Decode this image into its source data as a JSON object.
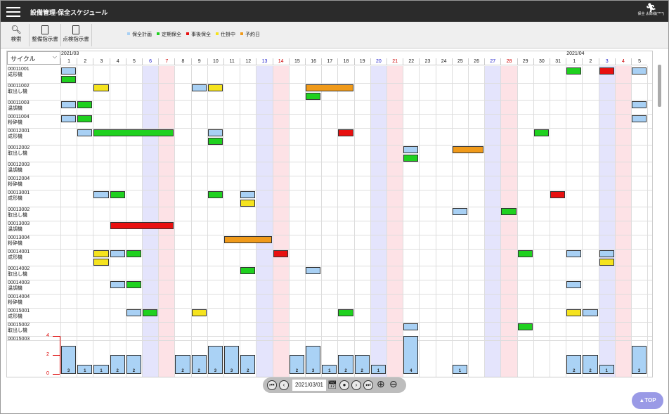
{
  "header": {
    "title": "設備管理-保全スケジュール",
    "user_role": "保全",
    "user_name": "太郎様(****)"
  },
  "toolbar": {
    "search": "検索",
    "maintenance_order": "整備指示書",
    "inspection_order": "点検指示書"
  },
  "legend": [
    {
      "label": "保全計画",
      "color": "#a8d0f4"
    },
    {
      "label": "定期保全",
      "color": "#1fd11f"
    },
    {
      "label": "事後保全",
      "color": "#e81010"
    },
    {
      "label": "仕掛中",
      "color": "#f5e31e"
    },
    {
      "label": "予約日",
      "color": "#f09a1a"
    }
  ],
  "cycle_select": "サイクル",
  "months": [
    {
      "label": "2021/03",
      "start": 0
    },
    {
      "label": "2021/04",
      "start": 31
    }
  ],
  "days": [
    "1",
    "2",
    "3",
    "4",
    "5",
    "6",
    "7",
    "8",
    "9",
    "10",
    "11",
    "12",
    "13",
    "14",
    "15",
    "16",
    "17",
    "18",
    "19",
    "20",
    "21",
    "22",
    "23",
    "24",
    "25",
    "26",
    "27",
    "28",
    "29",
    "30",
    "31",
    "1",
    "2",
    "3",
    "4",
    "5"
  ],
  "day_kinds": [
    "w",
    "w",
    "w",
    "w",
    "w",
    "sat",
    "sun",
    "w",
    "w",
    "w",
    "w",
    "w",
    "sat",
    "sun",
    "w",
    "w",
    "w",
    "w",
    "w",
    "sat",
    "sun",
    "w",
    "w",
    "w",
    "w",
    "w",
    "sat",
    "sun",
    "w",
    "w",
    "w",
    "w",
    "w",
    "sat",
    "sun",
    "w"
  ],
  "colors": {
    "plan": "#a8d0f4",
    "regular": "#1fd11f",
    "post": "#e81010",
    "wip": "#f5e31e",
    "reserve": "#f09a1a",
    "sat_bg": "#e4e4fc",
    "sun_bg": "#fde2e6",
    "sat_text": "#2222cc",
    "sun_text": "#cc0000"
  },
  "rows": [
    {
      "id": "00011001",
      "name": "成形機",
      "h": 24
    },
    {
      "id": "00011002",
      "name": "取出し機",
      "h": 24
    },
    {
      "id": "00011003",
      "name": "温調機",
      "h": 20
    },
    {
      "id": "00011004",
      "name": "粉砕機",
      "h": 20
    },
    {
      "id": "00012001",
      "name": "成形機",
      "h": 24
    },
    {
      "id": "00012002",
      "name": "取出し機",
      "h": 24
    },
    {
      "id": "00012003",
      "name": "温調機",
      "h": 20
    },
    {
      "id": "00012004",
      "name": "粉砕機",
      "h": 20
    },
    {
      "id": "00013001",
      "name": "成形機",
      "h": 24
    },
    {
      "id": "00013002",
      "name": "取出し機",
      "h": 20
    },
    {
      "id": "00013003",
      "name": "温調機",
      "h": 20
    },
    {
      "id": "00013004",
      "name": "粉砕機",
      "h": 20
    },
    {
      "id": "00014001",
      "name": "成形機",
      "h": 24
    },
    {
      "id": "00014002",
      "name": "取出し機",
      "h": 20
    },
    {
      "id": "00014003",
      "name": "温調機",
      "h": 20
    },
    {
      "id": "00014004",
      "name": "粉砕機",
      "h": 20
    },
    {
      "id": "00015001",
      "name": "成形機",
      "h": 20
    },
    {
      "id": "00015002",
      "name": "取出し機",
      "h": 20
    },
    {
      "id": "00015003",
      "name": "",
      "h": 6
    }
  ],
  "bars": [
    {
      "r": 0,
      "s": 0,
      "e": 0,
      "t": "plan",
      "l": 0
    },
    {
      "r": 0,
      "s": 0,
      "e": 0,
      "t": "regular",
      "l": 1
    },
    {
      "r": 0,
      "s": 31,
      "e": 31,
      "t": "regular",
      "l": 0
    },
    {
      "r": 0,
      "s": 33,
      "e": 33,
      "t": "post",
      "l": 0
    },
    {
      "r": 0,
      "s": 35,
      "e": 35,
      "t": "plan",
      "l": 0
    },
    {
      "r": 1,
      "s": 2,
      "e": 2,
      "t": "wip",
      "l": 0
    },
    {
      "r": 1,
      "s": 8,
      "e": 8,
      "t": "plan",
      "l": 0
    },
    {
      "r": 1,
      "s": 9,
      "e": 9,
      "t": "wip",
      "l": 0
    },
    {
      "r": 1,
      "s": 15,
      "e": 17,
      "t": "reserve",
      "l": 0
    },
    {
      "r": 1,
      "s": 15,
      "e": 15,
      "t": "regular",
      "l": 1
    },
    {
      "r": 2,
      "s": 0,
      "e": 0,
      "t": "plan",
      "l": 0
    },
    {
      "r": 2,
      "s": 1,
      "e": 1,
      "t": "regular",
      "l": 0
    },
    {
      "r": 2,
      "s": 35,
      "e": 35,
      "t": "plan",
      "l": 0
    },
    {
      "r": 3,
      "s": 0,
      "e": 0,
      "t": "plan",
      "l": 0
    },
    {
      "r": 3,
      "s": 1,
      "e": 1,
      "t": "regular",
      "l": 0
    },
    {
      "r": 3,
      "s": 35,
      "e": 35,
      "t": "plan",
      "l": 0
    },
    {
      "r": 4,
      "s": 1,
      "e": 1,
      "t": "plan",
      "l": 0
    },
    {
      "r": 4,
      "s": 2,
      "e": 6,
      "t": "regular",
      "l": 0
    },
    {
      "r": 4,
      "s": 9,
      "e": 9,
      "t": "plan",
      "l": 0
    },
    {
      "r": 4,
      "s": 9,
      "e": 9,
      "t": "regular",
      "l": 1
    },
    {
      "r": 4,
      "s": 17,
      "e": 17,
      "t": "post",
      "l": 0
    },
    {
      "r": 4,
      "s": 29,
      "e": 29,
      "t": "regular",
      "l": 0
    },
    {
      "r": 5,
      "s": 21,
      "e": 21,
      "t": "plan",
      "l": 0
    },
    {
      "r": 5,
      "s": 21,
      "e": 21,
      "t": "regular",
      "l": 1
    },
    {
      "r": 5,
      "s": 24,
      "e": 25,
      "t": "reserve",
      "l": 0
    },
    {
      "r": 8,
      "s": 2,
      "e": 2,
      "t": "plan",
      "l": 0
    },
    {
      "r": 8,
      "s": 3,
      "e": 3,
      "t": "regular",
      "l": 0
    },
    {
      "r": 8,
      "s": 9,
      "e": 9,
      "t": "regular",
      "l": 0
    },
    {
      "r": 8,
      "s": 11,
      "e": 11,
      "t": "plan",
      "l": 0
    },
    {
      "r": 8,
      "s": 11,
      "e": 11,
      "t": "wip",
      "l": 1
    },
    {
      "r": 8,
      "s": 30,
      "e": 30,
      "t": "post",
      "l": 0
    },
    {
      "r": 9,
      "s": 24,
      "e": 24,
      "t": "plan",
      "l": 0
    },
    {
      "r": 9,
      "s": 27,
      "e": 27,
      "t": "regular",
      "l": 0
    },
    {
      "r": 10,
      "s": 3,
      "e": 6,
      "t": "post",
      "l": 0
    },
    {
      "r": 11,
      "s": 10,
      "e": 12,
      "t": "reserve",
      "l": 0
    },
    {
      "r": 12,
      "s": 2,
      "e": 2,
      "t": "wip",
      "l": 0
    },
    {
      "r": 12,
      "s": 2,
      "e": 2,
      "t": "wip",
      "l": 1
    },
    {
      "r": 12,
      "s": 3,
      "e": 3,
      "t": "plan",
      "l": 0
    },
    {
      "r": 12,
      "s": 4,
      "e": 4,
      "t": "regular",
      "l": 0
    },
    {
      "r": 12,
      "s": 13,
      "e": 13,
      "t": "post",
      "l": 0
    },
    {
      "r": 12,
      "s": 28,
      "e": 28,
      "t": "regular",
      "l": 0
    },
    {
      "r": 12,
      "s": 31,
      "e": 31,
      "t": "plan",
      "l": 0
    },
    {
      "r": 12,
      "s": 33,
      "e": 33,
      "t": "plan",
      "l": 0
    },
    {
      "r": 12,
      "s": 33,
      "e": 33,
      "t": "wip",
      "l": 1
    },
    {
      "r": 13,
      "s": 11,
      "e": 11,
      "t": "regular",
      "l": 0
    },
    {
      "r": 13,
      "s": 15,
      "e": 15,
      "t": "plan",
      "l": 0
    },
    {
      "r": 14,
      "s": 3,
      "e": 3,
      "t": "plan",
      "l": 0
    },
    {
      "r": 14,
      "s": 4,
      "e": 4,
      "t": "regular",
      "l": 0
    },
    {
      "r": 14,
      "s": 31,
      "e": 31,
      "t": "plan",
      "l": 0
    },
    {
      "r": 16,
      "s": 4,
      "e": 4,
      "t": "plan",
      "l": 0
    },
    {
      "r": 16,
      "s": 5,
      "e": 5,
      "t": "regular",
      "l": 0
    },
    {
      "r": 16,
      "s": 8,
      "e": 8,
      "t": "wip",
      "l": 0
    },
    {
      "r": 16,
      "s": 17,
      "e": 17,
      "t": "regular",
      "l": 0
    },
    {
      "r": 16,
      "s": 31,
      "e": 31,
      "t": "wip",
      "l": 0
    },
    {
      "r": 16,
      "s": 32,
      "e": 32,
      "t": "plan",
      "l": 0
    },
    {
      "r": 17,
      "s": 21,
      "e": 21,
      "t": "plan",
      "l": 0
    },
    {
      "r": 17,
      "s": 28,
      "e": 28,
      "t": "regular",
      "l": 0
    }
  ],
  "chart_data": {
    "type": "bar",
    "ylim": [
      0,
      4
    ],
    "yticks": [
      "0",
      "2",
      "4"
    ],
    "values": [
      3,
      1,
      1,
      2,
      2,
      0,
      0,
      2,
      2,
      3,
      3,
      2,
      0,
      0,
      2,
      3,
      1,
      2,
      2,
      1,
      0,
      4,
      0,
      0,
      1,
      0,
      0,
      0,
      0,
      0,
      0,
      2,
      2,
      1,
      0,
      3
    ]
  },
  "pager": {
    "date": "2021/03/01"
  },
  "top_button": "▲TOP"
}
